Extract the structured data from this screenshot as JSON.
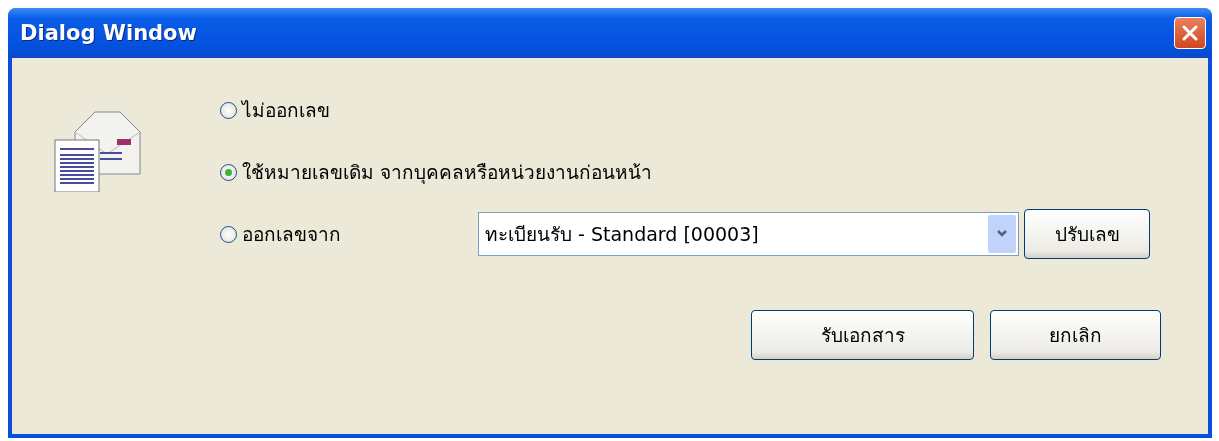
{
  "window": {
    "title": "Dialog Window"
  },
  "options": [
    {
      "label": "ไม่ออกเลข",
      "selected": false
    },
    {
      "label": "ใช้หมายเลขเดิม จากบุคคลหรือหน่วยงานก่อนหน้า",
      "selected": true
    },
    {
      "label": "ออกเลขจาก",
      "selected": false
    }
  ],
  "register_select": {
    "value": "ทะเบียนรับ - Standard [00003]"
  },
  "adjust_button": "ปรับเลข",
  "buttons": [
    "รับเอกสาร",
    "ยกเลิก"
  ]
}
